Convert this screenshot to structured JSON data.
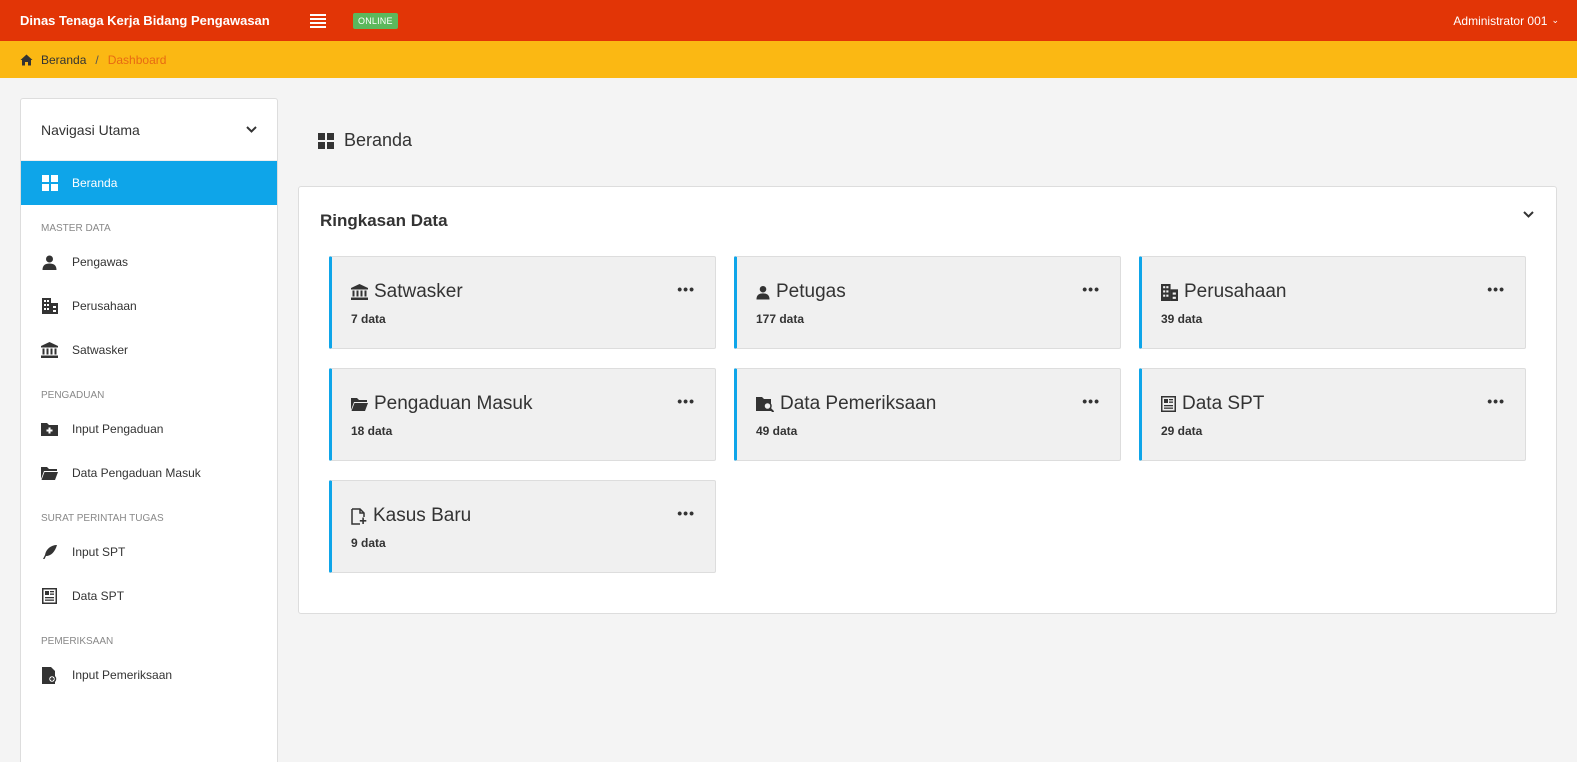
{
  "header": {
    "brand": "Dinas Tenaga Kerja Bidang Pengawasan",
    "status_badge": "ONLINE",
    "user_label": "Administrator 001",
    "user_caret": "⌄"
  },
  "breadcrumb": {
    "home_label": "Beranda",
    "separator": "/",
    "current_label": "Dashboard"
  },
  "sidebar": {
    "header_label": "Navigasi Utama",
    "items": {
      "beranda": "Beranda",
      "pengawas": "Pengawas",
      "perusahaan": "Perusahaan",
      "satwasker": "Satwasker",
      "input_pengaduan": "Input Pengaduan",
      "data_pengaduan_masuk": "Data Pengaduan Masuk",
      "input_spt": "Input SPT",
      "data_spt": "Data SPT",
      "input_pemeriksaan": "Input Pemeriksaan"
    },
    "sections": {
      "master_data": "MASTER DATA",
      "pengaduan": "PENGADUAN",
      "surat_perintah_tugas": "SURAT PERINTAH TUGAS",
      "pemeriksaan": "PEMERIKSAAN"
    }
  },
  "main": {
    "page_title": "Beranda",
    "panel_title": "Ringkasan Data",
    "card_menu": "•••",
    "cards": [
      {
        "title": "Satwasker",
        "count": "7 data",
        "icon": "bank-icon"
      },
      {
        "title": "Petugas",
        "count": "177 data",
        "icon": "user-icon"
      },
      {
        "title": "Perusahaan",
        "count": "39 data",
        "icon": "building-icon"
      },
      {
        "title": "Pengaduan Masuk",
        "count": "18 data",
        "icon": "folder-icon"
      },
      {
        "title": "Data Pemeriksaan",
        "count": "49 data",
        "icon": "folder-search-icon"
      },
      {
        "title": "Data SPT",
        "count": "29 data",
        "icon": "newspaper-icon"
      },
      {
        "title": "Kasus Baru",
        "count": "9 data",
        "icon": "file-plus-icon"
      }
    ]
  },
  "colors": {
    "topbar": "#e23506",
    "breadcrumb_bar": "#fbb813",
    "active_nav": "#0ea5e9",
    "card_accent": "#0ea5e9",
    "online_badge": "#5cb85c"
  }
}
